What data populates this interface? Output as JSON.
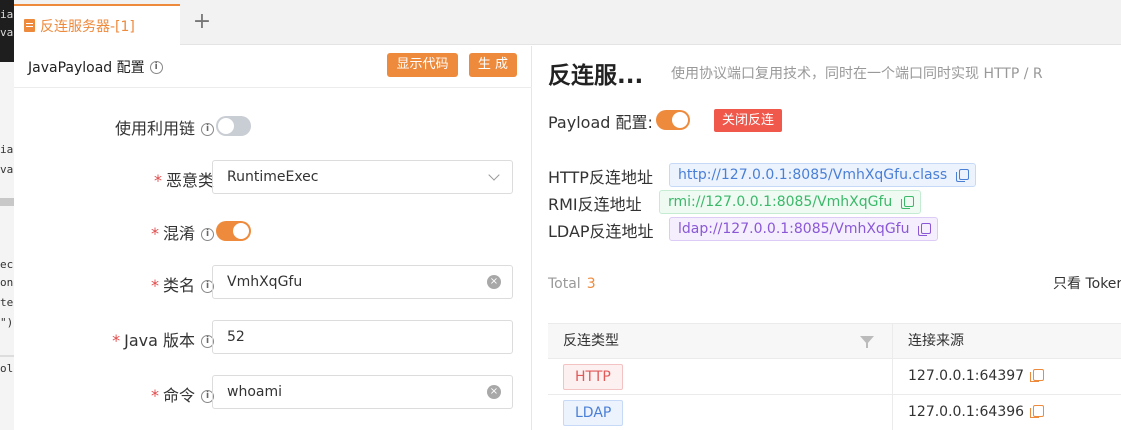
{
  "code_strip": {
    "top_lines": [
      "ia",
      "va"
    ],
    "mid_lines": [
      "ia",
      "va"
    ],
    "lower_lines": [
      "ec",
      "on",
      "te",
      "\")"
    ],
    "bottom_line": "ol"
  },
  "tabs": [
    {
      "label": "反连服务器-[1]",
      "icon": "file-icon",
      "active": true
    }
  ],
  "tab_add": "+",
  "left_panel": {
    "title": "JavaPayload 配置",
    "show_code_button": "显示代码",
    "generate_button": "生 成",
    "fields": {
      "use_chain": {
        "label": "使用利用链",
        "enabled": false
      },
      "malicious_class": {
        "label": "恶意类",
        "value": "RuntimeExec",
        "required": true
      },
      "obfuscation": {
        "label": "混淆",
        "enabled": true,
        "required": true
      },
      "class_name": {
        "label": "类名",
        "value": "VmhXqGfu",
        "required": true
      },
      "java_version": {
        "label": "Java 版本",
        "value": "52",
        "required": true
      },
      "command": {
        "label": "命令",
        "value": "whoami",
        "required": true
      }
    }
  },
  "right_panel": {
    "title": "反连服...",
    "description": "使用协议端口复用技术，同时在一个端口同时实现 HTTP / R",
    "payload_label": "Payload 配置:",
    "payload_enabled": true,
    "close_button": "关闭反连",
    "addresses": [
      {
        "label": "HTTP反连地址",
        "value": "http://127.0.0.1:8085/VmhXqGfu.class",
        "color": "#4a7fd6"
      },
      {
        "label": "RMI反连地址",
        "value": "rmi://127.0.0.1:8085/VmhXqGfu",
        "color": "#3cb86a"
      },
      {
        "label": "LDAP反连地址",
        "value": "ldap://127.0.0.1:8085/VmhXqGfu",
        "color": "#8a58d6"
      }
    ],
    "total_label": "Total",
    "total_count": "3",
    "only_token_label": "只看 Toker",
    "table": {
      "headers": [
        "反连类型",
        "连接来源"
      ],
      "rows": [
        {
          "type": "HTTP",
          "source": "127.0.0.1:64397"
        },
        {
          "type": "LDAP",
          "source": "127.0.0.1:64396"
        }
      ]
    }
  },
  "colors": {
    "accent": "#ee8a3c",
    "danger": "#f0584c"
  }
}
